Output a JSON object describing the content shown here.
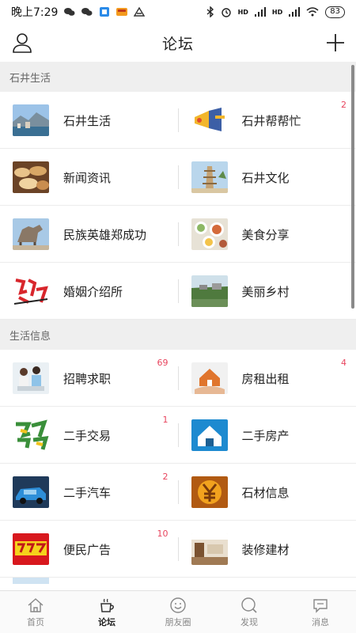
{
  "status": {
    "time": "晚上7:29",
    "network_a": "HD",
    "network_b": "HD",
    "battery": "83"
  },
  "header": {
    "title": "论坛"
  },
  "sections": [
    {
      "title": "石井生活",
      "rows": [
        [
          {
            "label": "石井生活",
            "badge": "",
            "icon": "landscape-thumbnail"
          },
          {
            "label": "石井帮帮忙",
            "badge": "2",
            "icon": "megaphone-thumbnail"
          }
        ],
        [
          {
            "label": "新闻资讯",
            "badge": "",
            "icon": "bread-thumbnail"
          },
          {
            "label": "石井文化",
            "badge": "",
            "icon": "pagoda-thumbnail"
          }
        ],
        [
          {
            "label": "民族英雄郑成功",
            "badge": "",
            "icon": "horse-statue-thumbnail"
          },
          {
            "label": "美食分享",
            "badge": "",
            "icon": "food-thumbnail"
          }
        ],
        [
          {
            "label": "婚姻介绍所",
            "badge": "",
            "icon": "calligraphy-thumbnail"
          },
          {
            "label": "美丽乡村",
            "badge": "",
            "icon": "village-thumbnail"
          }
        ]
      ]
    },
    {
      "title": "生活信息",
      "rows": [
        [
          {
            "label": "招聘求职",
            "badge": "69",
            "icon": "office-people-thumbnail"
          },
          {
            "label": "房租出租",
            "badge": "4",
            "icon": "house-hand-thumbnail"
          }
        ],
        [
          {
            "label": "二手交易",
            "badge": "1",
            "icon": "trade-text-thumbnail"
          },
          {
            "label": "二手房产",
            "badge": "",
            "icon": "house-blue-thumbnail"
          }
        ],
        [
          {
            "label": "二手汽车",
            "badge": "2",
            "icon": "car-thumbnail"
          },
          {
            "label": "石材信息",
            "badge": "",
            "icon": "yen-thumbnail"
          }
        ],
        [
          {
            "label": "便民广告",
            "badge": "10",
            "icon": "ad-banner-thumbnail"
          },
          {
            "label": "装修建材",
            "badge": "",
            "icon": "interior-thumbnail"
          }
        ]
      ]
    }
  ],
  "nav": [
    {
      "label": "首页",
      "icon": "home-icon"
    },
    {
      "label": "论坛",
      "icon": "coffee-icon",
      "active": true
    },
    {
      "label": "朋友圈",
      "icon": "smile-icon"
    },
    {
      "label": "发现",
      "icon": "discover-icon"
    },
    {
      "label": "消息",
      "icon": "message-icon"
    }
  ]
}
